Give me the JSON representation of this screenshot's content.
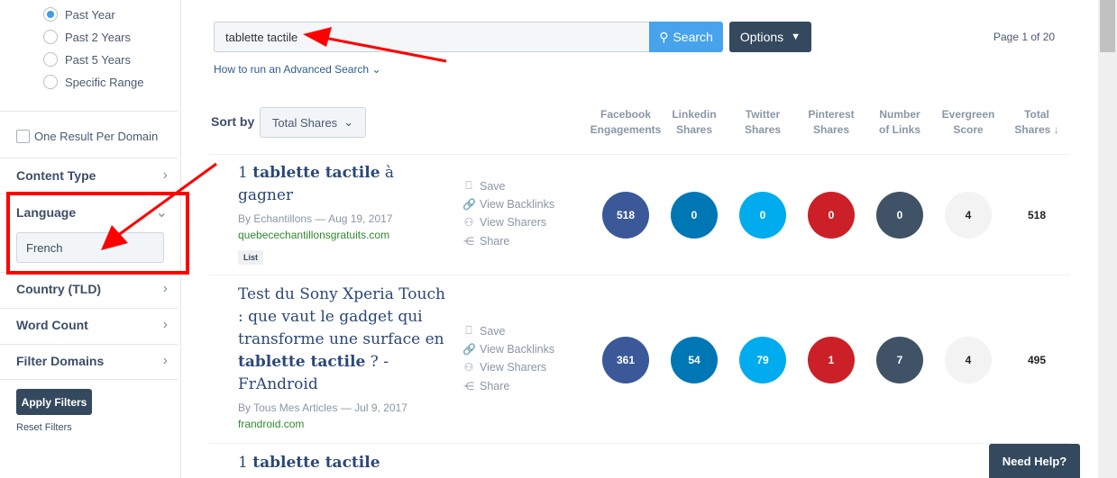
{
  "sidebar": {
    "date_options": [
      {
        "label": "Past Year",
        "selected": true
      },
      {
        "label": "Past 2 Years",
        "selected": false
      },
      {
        "label": "Past 5 Years",
        "selected": false
      },
      {
        "label": "Specific Range",
        "selected": false
      }
    ],
    "one_per_domain": "One Result Per Domain",
    "sections": [
      "Content Type",
      "Language",
      "Country (TLD)",
      "Word Count",
      "Filter Domains"
    ],
    "language_value": "French",
    "apply": "Apply Filters",
    "reset": "Reset Filters"
  },
  "search": {
    "query": "tablette tactile",
    "button": "Search",
    "options": "Options",
    "advanced": "How to run an Advanced Search",
    "page": "Page 1 of 20"
  },
  "sort": {
    "label": "Sort by",
    "value": "Total Shares"
  },
  "columns": [
    [
      "Facebook",
      "Engagements"
    ],
    [
      "Linkedin",
      "Shares"
    ],
    [
      "Twitter",
      "Shares"
    ],
    [
      "Pinterest",
      "Shares"
    ],
    [
      "Number",
      "of Links"
    ],
    [
      "Evergreen",
      "Score"
    ],
    [
      "Total",
      "Shares ↓"
    ]
  ],
  "actions": [
    "Save",
    "View Backlinks",
    "View Sharers",
    "Share"
  ],
  "colors": {
    "facebook": "#3b5998",
    "linkedin": "#0077b5",
    "twitter": "#00aced",
    "pinterest": "#cb2027",
    "links": "#3f5266",
    "evergreen": "#f3f3f3",
    "accent": "#46a3ec",
    "dark": "#34495e"
  },
  "results": [
    {
      "title_pre": "1 ",
      "title_bold": "tablette tactile",
      "title_post": " à gagner",
      "author": "By Echantillons",
      "date": "Aug 19, 2017",
      "domain": "quebecechantillonsgratuits.com",
      "tag": "List",
      "facebook": "518",
      "linkedin": "0",
      "twitter": "0",
      "pinterest": "0",
      "links": "0",
      "evergreen": "4",
      "total": "518"
    },
    {
      "title_pre": "Test du Sony Xperia Touch : que vaut le gadget qui transforme une surface en ",
      "title_bold": "tablette tactile",
      "title_post": " ? - FrAndroid",
      "author": "By Tous Mes Articles",
      "date": "Jul 9, 2017",
      "domain": "frandroid.com",
      "facebook": "361",
      "linkedin": "54",
      "twitter": "79",
      "pinterest": "1",
      "links": "7",
      "evergreen": "4",
      "total": "495"
    },
    {
      "title_pre": "1 ",
      "title_bold": "tablette tactile"
    }
  ],
  "help": "Need Help?"
}
